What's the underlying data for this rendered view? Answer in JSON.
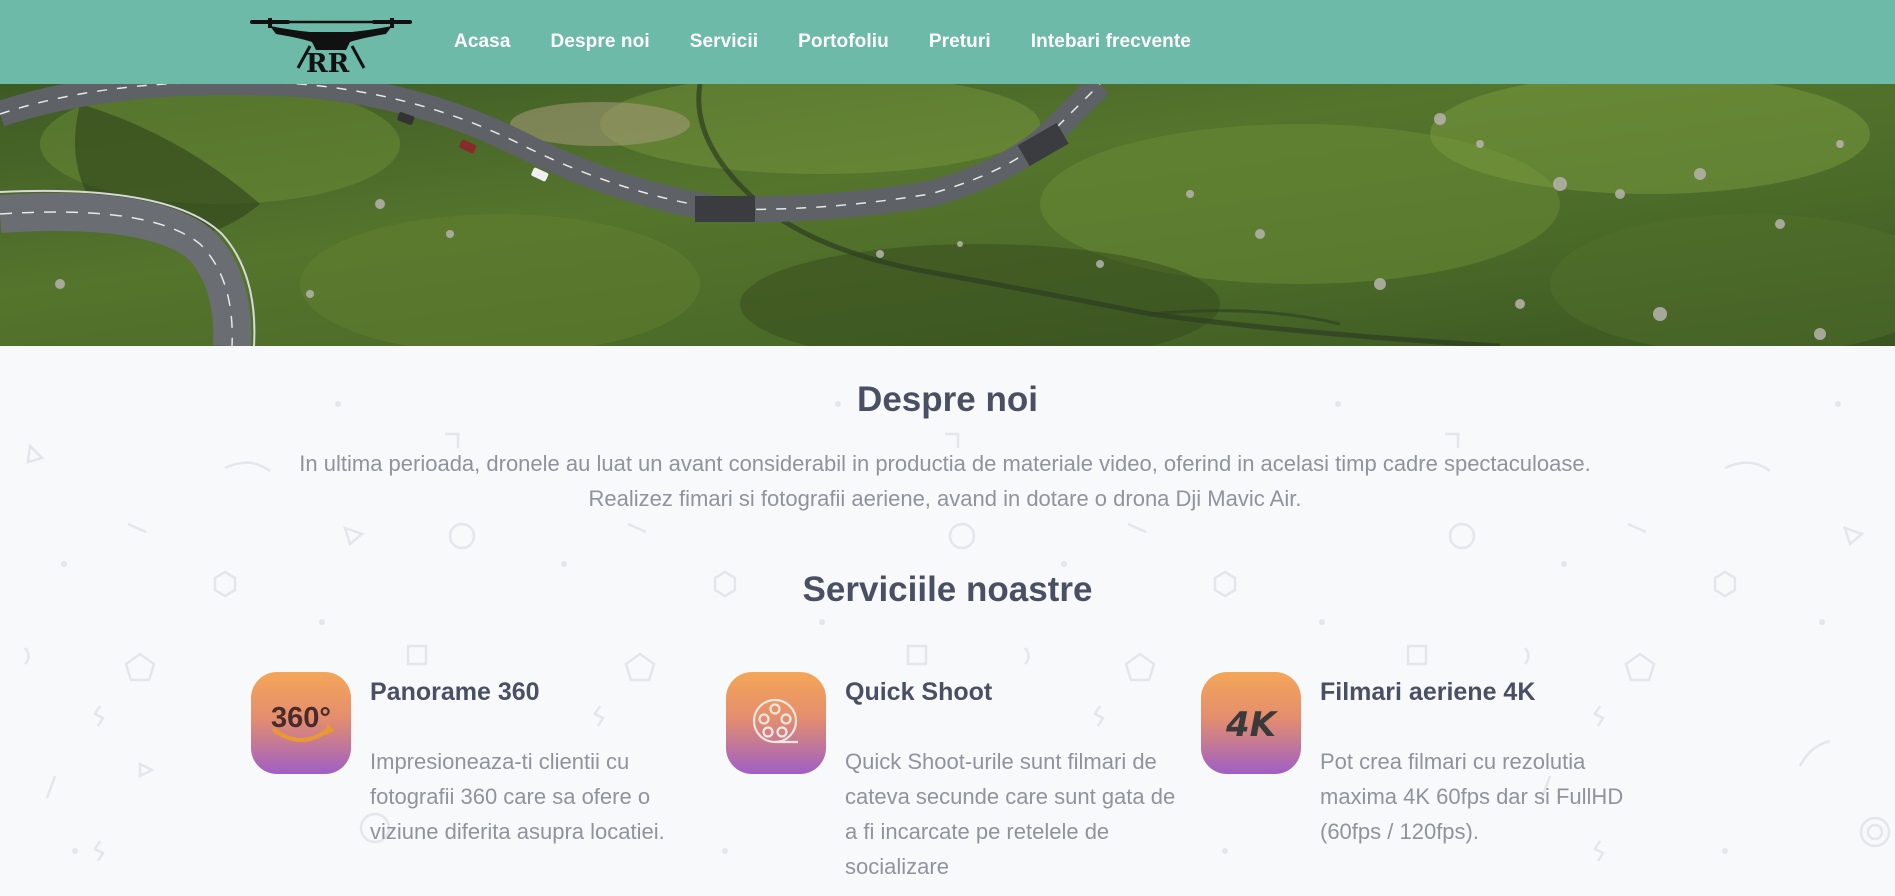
{
  "nav": {
    "logo": "drone-logo",
    "items": [
      {
        "label": "Acasa"
      },
      {
        "label": "Despre noi"
      },
      {
        "label": "Servicii"
      },
      {
        "label": "Portofoliu"
      },
      {
        "label": "Preturi"
      },
      {
        "label": "Intebari frecvente"
      }
    ]
  },
  "hero": {
    "image": "aerial-mountain-road-photo"
  },
  "about": {
    "title": "Despre noi",
    "text": "In ultima perioada, dronele au luat un avant considerabil in productia de materiale video, oferind in acelasi timp cadre spectaculoase. Realizez fimari si fotografii aeriene, avand in dotare o drona Dji Mavic Air."
  },
  "services": {
    "title": "Serviciile noastre",
    "items": [
      {
        "title": "Panorame 360",
        "icon": "360-panorama-icon",
        "icon_text": "360°",
        "desc": "Impresioneaza-ti clientii cu fotografii 360 care sa ofere o viziune diferita asupra locatiei."
      },
      {
        "title": "Quick Shoot",
        "icon": "film-reel-icon",
        "desc": "Quick Shoot-urile sunt filmari de cateva secunde care sunt gata de a fi incarcate pe retelele de socializare"
      },
      {
        "title": "Filmari aeriene 4K",
        "icon": "4k-icon",
        "icon_text": "4K",
        "desc": "Pot crea filmari cu rezolutia maxima 4K 60fps dar si FullHD (60fps / 120fps)."
      }
    ]
  },
  "colors": {
    "navbar": "#6cbaa7",
    "heading": "#4a5064",
    "body_text": "#8f939c",
    "icon_gradient_top": "#f4a657",
    "icon_gradient_bottom": "#9f5fc6"
  }
}
